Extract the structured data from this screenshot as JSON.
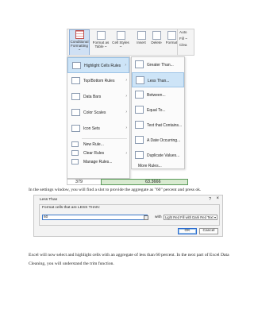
{
  "ribbon": {
    "conditional_formatting": "Conditional Formatting ~",
    "format_as": "Format as Table ~",
    "cell_styles": "Cell Styles ~",
    "insert": "Insert",
    "delete": "Delete",
    "format": "Format",
    "autosum": "Auto",
    "fill": "Fill ~",
    "clear": "Clea"
  },
  "menu": {
    "items": [
      {
        "label": "Highlight Cells Rules",
        "arrow": "›"
      },
      {
        "label": "Top/Bottom Rules",
        "arrow": "›"
      },
      {
        "label": "Data Bars",
        "arrow": "›"
      },
      {
        "label": "Color Scales",
        "arrow": "›"
      },
      {
        "label": "Icon Sets",
        "arrow": "›"
      }
    ],
    "small_items": [
      "New Rule...",
      "Clear Rules",
      "Manage Rules..."
    ],
    "small_arrow": "›"
  },
  "submenu": {
    "items": [
      "Greater Than...",
      "Less Than...",
      "Between...",
      "Equal To...",
      "Text that Contains...",
      "A Date Occurring...",
      "Duplicate Values..."
    ],
    "more": "More Rules..."
  },
  "cells": {
    "a": "379",
    "b": "63.3666"
  },
  "paragraph1": "In the settings window, you will find a slot to provide the aggregate as \"60\" percent and press ok.",
  "dialog": {
    "title": "Less Than",
    "help": "?",
    "close": "×",
    "format_label": "Format cells that are LESS THAN:",
    "input_value": "60",
    "with_label": "with",
    "select_value": "Light Red Fill with Dark Red Text",
    "select_arrow": "▾",
    "ok": "OK",
    "cancel": "Cancel"
  },
  "paragraph2": "Excel will now select and highlight cells with an aggregate of less than 60 percent. In the next part of Excel Data Cleaning, you will understand the trim function."
}
